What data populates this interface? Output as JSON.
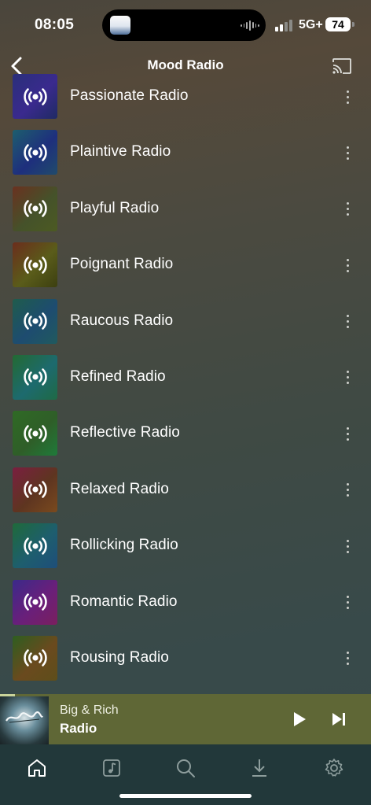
{
  "status_bar": {
    "time": "08:05",
    "network": "5G+",
    "battery": "74",
    "icons": [
      "signal-icon",
      "battery-icon"
    ]
  },
  "header": {
    "title": "Mood Radio",
    "back_icon": "chevron-left-icon",
    "cast_icon": "cast-icon"
  },
  "stations": [
    {
      "label": "Passionate Radio",
      "colors": [
        "#2a2f7a",
        "#3a2a8e",
        "#1f2a63"
      ]
    },
    {
      "label": "Plaintive Radio",
      "colors": [
        "#1d5e6d",
        "#1e2f7d",
        "#204b6b"
      ]
    },
    {
      "label": "Playful Radio",
      "colors": [
        "#6a3120",
        "#45522a",
        "#4c5a22"
      ]
    },
    {
      "label": "Poignant Radio",
      "colors": [
        "#6b2d1c",
        "#5a5c1a",
        "#3c3f10"
      ]
    },
    {
      "label": "Raucous Radio",
      "colors": [
        "#1f5c4c",
        "#1e4c70",
        "#205a5e"
      ]
    },
    {
      "label": "Refined Radio",
      "colors": [
        "#236a32",
        "#1d6a6e",
        "#1f6a45"
      ]
    },
    {
      "label": "Reflective Radio",
      "colors": [
        "#2f6a25",
        "#2f5e28",
        "#1f7a3a"
      ]
    },
    {
      "label": "Relaxed Radio",
      "colors": [
        "#7a1f40",
        "#5e3520",
        "#7a4a1e"
      ]
    },
    {
      "label": "Rollicking Radio",
      "colors": [
        "#1f6a3a",
        "#1e5e6e",
        "#1e4e7a"
      ]
    },
    {
      "label": "Romantic Radio",
      "colors": [
        "#3b2a8a",
        "#6a1f7a",
        "#7a1f5e"
      ]
    },
    {
      "label": "Rousing Radio",
      "colors": [
        "#2e5e20",
        "#6a4a1e",
        "#5e4e1a"
      ]
    }
  ],
  "station_icon": "radio-broadcast-icon",
  "row_menu_icon": "more-vertical-icon",
  "now_playing": {
    "artist": "Big & Rich",
    "title": "Radio",
    "progress": 0.04,
    "play_icon": "play-icon",
    "next_icon": "skip-next-icon"
  },
  "tabs": [
    {
      "icon": "home-icon",
      "active": true
    },
    {
      "icon": "music-note-icon",
      "active": false
    },
    {
      "icon": "search-icon",
      "active": false
    },
    {
      "icon": "download-icon",
      "active": false
    },
    {
      "icon": "settings-gear-icon",
      "active": false
    }
  ]
}
